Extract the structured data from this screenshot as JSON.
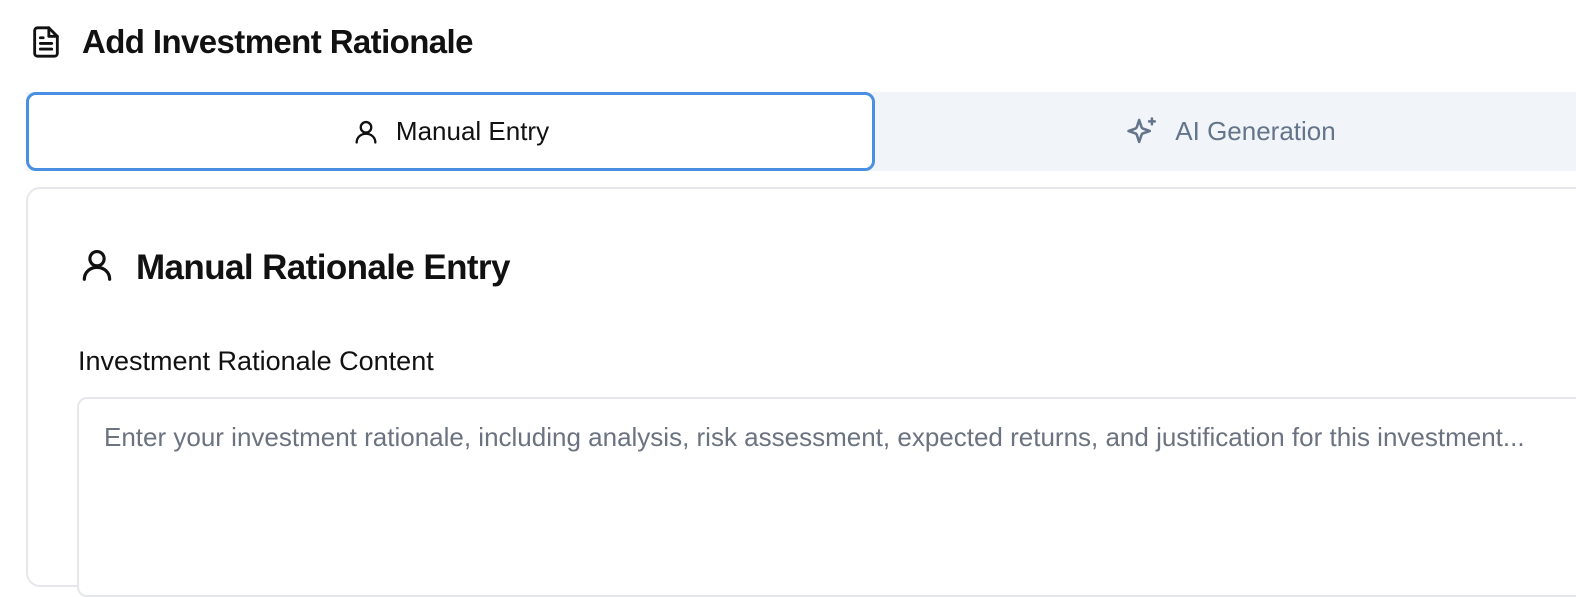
{
  "header": {
    "title": "Add Investment Rationale",
    "icon": "document-icon"
  },
  "tabs": [
    {
      "label": "Manual Entry",
      "icon": "user-icon",
      "active": true
    },
    {
      "label": "AI Generation",
      "icon": "sparkles-icon",
      "active": false
    }
  ],
  "card": {
    "title": "Manual Rationale Entry",
    "icon": "user-icon",
    "field_label": "Investment Rationale Content",
    "textarea": {
      "value": "",
      "placeholder": "Enter your investment rationale, including analysis, risk assessment, expected returns, and justification for this investment..."
    }
  },
  "colors": {
    "active_tab_border": "#4a90e2",
    "tab_bar_background": "#f1f5f9",
    "inactive_tab_text": "#64748b",
    "placeholder_text": "#6b7280"
  }
}
